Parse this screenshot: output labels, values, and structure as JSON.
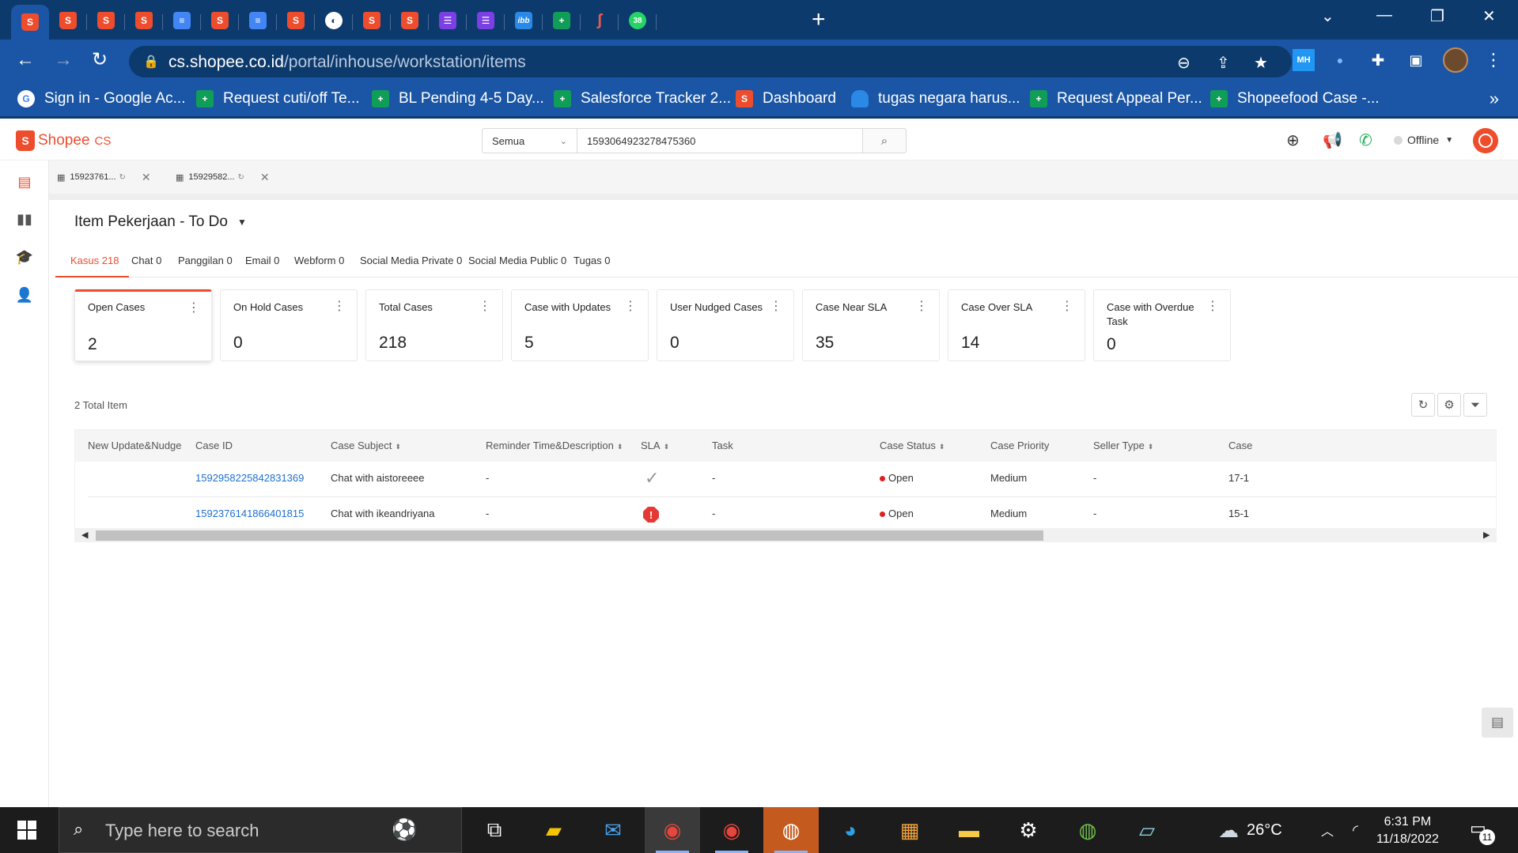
{
  "browser": {
    "tabs": [
      {
        "icon": "shopee",
        "glyph": "S",
        "active": true
      },
      {
        "icon": "shopee",
        "glyph": "S"
      },
      {
        "icon": "shopee",
        "glyph": "S"
      },
      {
        "icon": "shopee",
        "glyph": "S"
      },
      {
        "icon": "docs",
        "glyph": "≡"
      },
      {
        "icon": "shopee",
        "glyph": "S"
      },
      {
        "icon": "docs",
        "glyph": "≡"
      },
      {
        "icon": "shopee",
        "glyph": "S"
      },
      {
        "icon": "globe",
        "glyph": "◐"
      },
      {
        "icon": "shopee",
        "glyph": "S"
      },
      {
        "icon": "shopee",
        "glyph": "S"
      },
      {
        "icon": "list",
        "glyph": "☰"
      },
      {
        "icon": "list",
        "glyph": "☰"
      },
      {
        "icon": "ibb",
        "glyph": "ibb"
      },
      {
        "icon": "sheet",
        "glyph": "+"
      },
      {
        "icon": "hook",
        "glyph": "ʃ"
      },
      {
        "icon": "wa",
        "glyph": "38"
      }
    ],
    "url_domain": "cs.shopee.co.id",
    "url_path": "/portal/inhouse/workstation/items",
    "profile_ext_label": "MH",
    "bookmarks": [
      {
        "icon": "g",
        "glyph": "G",
        "label": "Sign in - Google Ac..."
      },
      {
        "icon": "sheet",
        "glyph": "+",
        "label": "Request cuti/off Te..."
      },
      {
        "icon": "sheet",
        "glyph": "+",
        "label": "BL Pending 4-5 Day..."
      },
      {
        "icon": "sheet",
        "glyph": "+",
        "label": "Salesforce Tracker 2..."
      },
      {
        "icon": "shop",
        "glyph": "S",
        "label": "Dashboard"
      },
      {
        "icon": "cloud",
        "glyph": "",
        "label": "tugas negara harus..."
      },
      {
        "icon": "sheet",
        "glyph": "+",
        "label": "Request Appeal Per..."
      },
      {
        "icon": "sheet",
        "glyph": "+",
        "label": "Shopeefood Case -..."
      }
    ]
  },
  "app": {
    "brand": "Shopee",
    "brand_suffix": "CS",
    "search_scope": "Semua",
    "search_value": "1593064923278475360",
    "status": "Offline",
    "work_tabs": [
      {
        "label": "15923761..."
      },
      {
        "label": "15929582..."
      }
    ],
    "page_title": "Item Pekerjaan - To Do",
    "channel_tabs": [
      {
        "label": "Kasus 218",
        "active": true
      },
      {
        "label": "Chat 0"
      },
      {
        "label": "Panggilan 0"
      },
      {
        "label": "Email 0"
      },
      {
        "label": "Webform 0"
      },
      {
        "label": "Social Media Private 0"
      },
      {
        "label": "Social Media Public 0"
      },
      {
        "label": "Tugas 0"
      }
    ],
    "cards": [
      {
        "label": "Open Cases",
        "value": "2",
        "active": true
      },
      {
        "label": "On Hold Cases",
        "value": "0"
      },
      {
        "label": "Total Cases",
        "value": "218"
      },
      {
        "label": "Case with Updates",
        "value": "5"
      },
      {
        "label": "User Nudged Cases",
        "value": "0"
      },
      {
        "label": "Case Near SLA",
        "value": "35"
      },
      {
        "label": "Case Over SLA",
        "value": "14"
      },
      {
        "label": "Case with Overdue Task",
        "value": "0"
      }
    ],
    "total_items": "2 Total Item",
    "table": {
      "columns": [
        "New Update&Nudge",
        "Case ID",
        "Case Subject",
        "Reminder Time&Description",
        "SLA",
        "Task",
        "Case Status",
        "Case Priority",
        "Seller Type",
        "Case"
      ],
      "rows": [
        {
          "case_id": "1592958225842831369",
          "subject": "Chat with aistoreeee",
          "reminder": "-",
          "sla": "ok",
          "task": "-",
          "status": "Open",
          "priority": "Medium",
          "seller_type": "-",
          "case_date": "17-1"
        },
        {
          "case_id": "1592376141866401815",
          "subject": "Chat with ikeandriyana",
          "reminder": "-",
          "sla": "overdue",
          "task": "-",
          "status": "Open",
          "priority": "Medium",
          "seller_type": "-",
          "case_date": "15-1"
        }
      ]
    }
  },
  "taskbar": {
    "search_placeholder": "Type here to search",
    "weather": "26°C",
    "time": "6:31 PM",
    "date": "11/18/2022",
    "notifications": "11",
    "colors": {
      "accent": "#ee4d2d",
      "link": "#1e6fd1",
      "chrome": "#1a56a5"
    }
  }
}
